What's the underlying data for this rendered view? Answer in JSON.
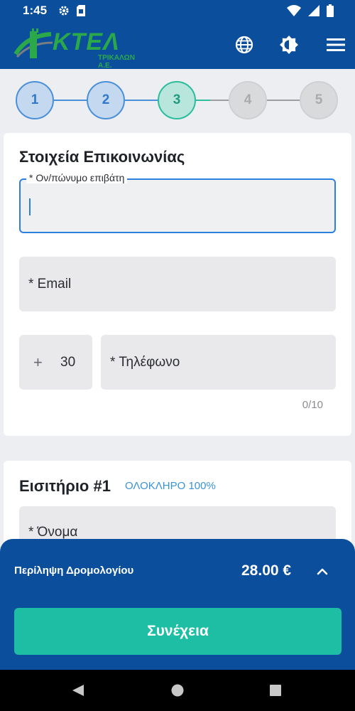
{
  "status_bar": {
    "time": "1:45"
  },
  "header": {
    "logo_text": "ΚΤΕΛ",
    "logo_subtext": "ΤΡΙΚΑΛΩΝ Α.Ε.",
    "icons": [
      "globe-icon",
      "brightness-icon",
      "menu-icon"
    ]
  },
  "stepper": {
    "steps": [
      "1",
      "2",
      "3",
      "4",
      "5"
    ],
    "current_step": 3,
    "colors": {
      "done": "#4a90d9",
      "current": "#2bbd9c",
      "todo": "#cfd0d2"
    }
  },
  "contact_card": {
    "title": "Στοιχεία Επικοινωνίας",
    "full_name_label": "* Ον/πώνυμο επιβάτη",
    "full_name_value": "",
    "email_label": "*  Email",
    "country_code_prefix": "+",
    "country_code_value": "30",
    "phone_label": "*  Τηλέφωνο",
    "phone_counter": "0/10"
  },
  "ticket_card": {
    "title": "Εισιτήριο #1",
    "ticket_type": "ΟΛΟΚΛΗΡΟ 100%",
    "first_name_label": "*  Όνομα"
  },
  "bottom_sheet": {
    "summary_label": "Περίληψη Δρομολογίου",
    "price": "28.00 €",
    "continue_label": "Συνέχεια"
  },
  "colors": {
    "brand_blue": "#0b4f9c",
    "accent_teal": "#1ebea5",
    "focus_blue": "#2c7fdd"
  }
}
